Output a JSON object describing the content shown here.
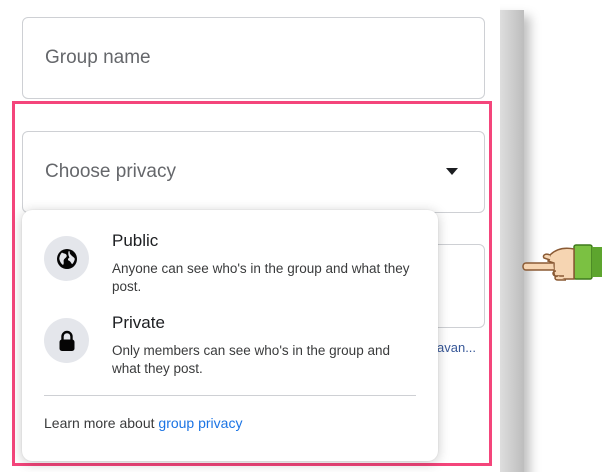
{
  "form": {
    "group_name_placeholder": "Group name",
    "privacy_placeholder": "Choose privacy",
    "background_link_fragment": "avan..."
  },
  "privacy_menu": {
    "options": [
      {
        "title": "Public",
        "description": "Anyone can see who's in the group and what they post.",
        "icon": "globe-icon"
      },
      {
        "title": "Private",
        "description": "Only members can see who's in the group and what they post.",
        "icon": "lock-icon"
      }
    ],
    "footer_text": "Learn more about ",
    "footer_link": "group privacy"
  },
  "annotations": {
    "highlight_color": "#f4457b",
    "pointer": "pointing-hand-icon"
  },
  "colors": {
    "link": "#1b74e4",
    "text_primary": "#1c1e21",
    "text_secondary": "#65676b",
    "border": "#ced0d4"
  }
}
